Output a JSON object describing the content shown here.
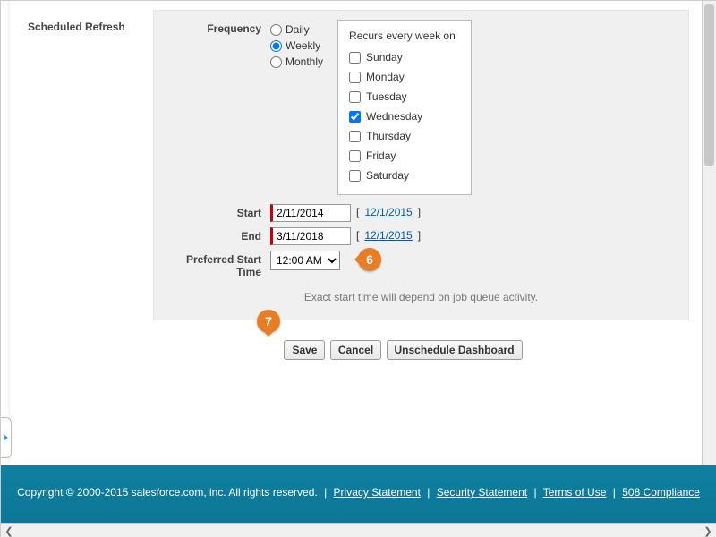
{
  "sectionTitle": "Scheduled Refresh",
  "frequency": {
    "label": "Frequency",
    "options": {
      "daily": "Daily",
      "weekly": "Weekly",
      "monthly": "Monthly"
    },
    "selected": "weekly",
    "recursTitle": "Recurs every week on",
    "days": {
      "sunday": "Sunday",
      "monday": "Monday",
      "tuesday": "Tuesday",
      "wednesday": "Wednesday",
      "thursday": "Thursday",
      "friday": "Friday",
      "saturday": "Saturday"
    },
    "checkedDay": "wednesday"
  },
  "start": {
    "label": "Start",
    "value": "2/11/2014",
    "hint": "12/1/2015"
  },
  "end": {
    "label": "End",
    "value": "3/11/2018",
    "hint": "12/1/2015"
  },
  "preferredStartTime": {
    "label": "Preferred Start Time",
    "value": "12:00 AM"
  },
  "note": "Exact start time will depend on job queue activity.",
  "buttons": {
    "save": "Save",
    "cancel": "Cancel",
    "unschedule": "Unschedule Dashboard"
  },
  "callouts": {
    "six": "6",
    "seven": "7"
  },
  "footer": {
    "copyright": "Copyright © 2000-2015 salesforce.com, inc. All rights reserved.",
    "privacy": "Privacy Statement",
    "security": "Security Statement",
    "terms": "Terms of Use",
    "compliance": "508 Compliance",
    "pipe": "|"
  }
}
